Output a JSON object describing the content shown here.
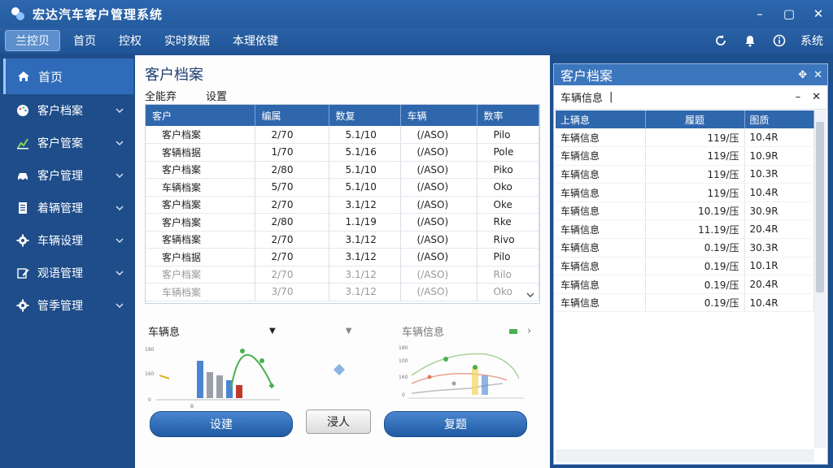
{
  "app": {
    "title": "宏达汽车客户管理系统"
  },
  "menu": {
    "items": [
      "兰控贝",
      "首页",
      "控权",
      "实时数据",
      "本理依键"
    ],
    "right_label": "系统"
  },
  "sidebar": {
    "items": [
      {
        "label": "首页",
        "icon": "home-icon"
      },
      {
        "label": "客户档案",
        "icon": "palette-icon"
      },
      {
        "label": "客户管案",
        "icon": "chart-icon"
      },
      {
        "label": "客户管理",
        "icon": "car-icon"
      },
      {
        "label": "着辆管理",
        "icon": "document-icon"
      },
      {
        "label": "车辆设理",
        "icon": "gear-icon"
      },
      {
        "label": "观语管理",
        "icon": "edit-icon"
      },
      {
        "label": "管季管理",
        "icon": "gear-icon"
      }
    ]
  },
  "main": {
    "title": "客户档案",
    "tabs": [
      "全能弃",
      "设置"
    ],
    "table": {
      "headers": [
        "客户",
        "编属",
        "数复",
        "车辆",
        "数率"
      ],
      "rows": [
        [
          "客户档案",
          "2/70",
          "5.1/10",
          "(/ASO)",
          "Pilo"
        ],
        [
          "客辆档据",
          "1/70",
          "5.1/16",
          "(/ASO)",
          "Pole"
        ],
        [
          "客户档案",
          "2/80",
          "5.1/10",
          "(/ASO)",
          "Piko"
        ],
        [
          "车辆档案",
          "5/70",
          "5.1/10",
          "(/ASO)",
          "Oko"
        ],
        [
          "客户档案",
          "2/70",
          "3.1/12",
          "(/ASO)",
          "Oke"
        ],
        [
          "客户档案",
          "2/80",
          "1.1/19",
          "(/ASO)",
          "Rke"
        ],
        [
          "客辆档案",
          "2/70",
          "3.1/12",
          "(/ASO)",
          "Rivo"
        ],
        [
          "客户档据",
          "2/70",
          "3.1/12",
          "(/ASO)",
          "Pilo"
        ],
        [
          "客户档案",
          "2/70",
          "3.1/12",
          "(/ASO)",
          "Rilo"
        ],
        [
          "车辆档案",
          "3/70",
          "3.1/12",
          "(/ASO)",
          "Oko"
        ]
      ]
    },
    "left_card_title": "车辆息",
    "right_card_title": "车辆信息",
    "left_chart_ticks": [
      "180",
      "160",
      "0"
    ],
    "left_chart_x_label": "B",
    "right_chart_ticks": [
      "180",
      "100",
      "160",
      "0"
    ],
    "buttons": {
      "create": "设建",
      "import": "浸人",
      "query": "复题"
    }
  },
  "right_panel": {
    "title": "客户档案",
    "search_label": "车辆信息",
    "table": {
      "headers": [
        "上辆息",
        "履题",
        "图质"
      ],
      "rows": [
        [
          "车辆信息",
          "119/压",
          "10.4R"
        ],
        [
          "车辆信息",
          "119/压",
          "10.9R"
        ],
        [
          "车辆信息",
          "119/压",
          "10.3R"
        ],
        [
          "车辆信息",
          "119/压",
          "10.4R"
        ],
        [
          "车辆信息",
          "10.19/压",
          "30.9R"
        ],
        [
          "车辆信息",
          "11.19/压",
          "20.4R"
        ],
        [
          "车辆信息",
          "0.19/压",
          "30.3R"
        ],
        [
          "车辆信息",
          "0.19/压",
          "10.1R"
        ],
        [
          "车辆信息",
          "0.19/压",
          "20.4R"
        ],
        [
          "车辆信息",
          "0.19/压",
          "10.4R"
        ]
      ]
    }
  },
  "colors": {
    "primary": "#2f67ad",
    "sidebar": "#1e4d8a",
    "accent_green": "#4caf50",
    "bar_blue": "#4a86cf",
    "bar_gray": "#9aa0a8",
    "bar_red": "#c0392b"
  }
}
